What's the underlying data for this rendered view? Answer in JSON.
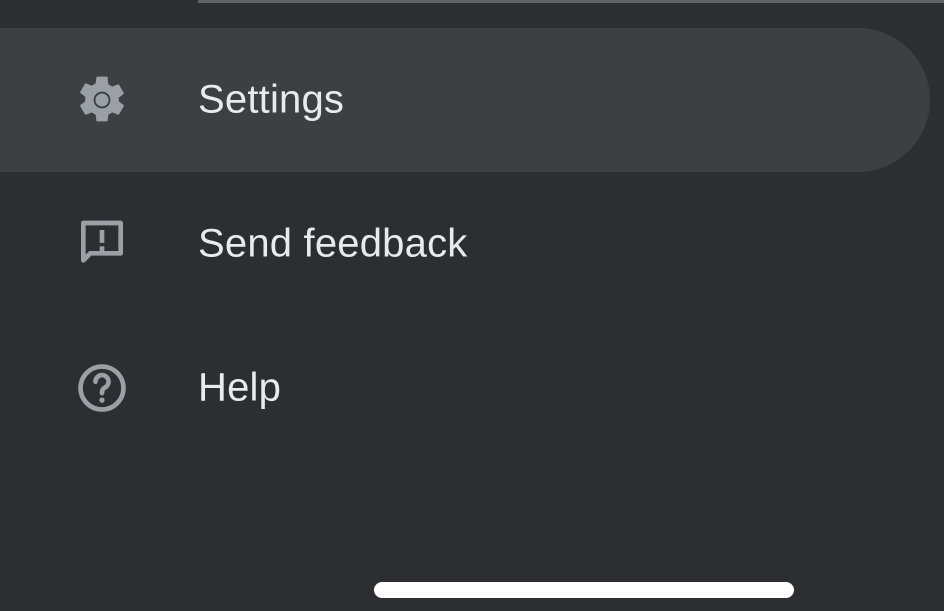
{
  "menu": {
    "items": [
      {
        "label": "Settings",
        "icon": "gear-icon",
        "active": true
      },
      {
        "label": "Send feedback",
        "icon": "feedback-icon",
        "active": false
      },
      {
        "label": "Help",
        "icon": "help-icon",
        "active": false
      }
    ]
  },
  "colors": {
    "background": "#2d2e31",
    "active_item_background": "#3c4043",
    "text": "#e8eaed",
    "icon": "#9aa0a6",
    "home_indicator": "#ffffff"
  }
}
